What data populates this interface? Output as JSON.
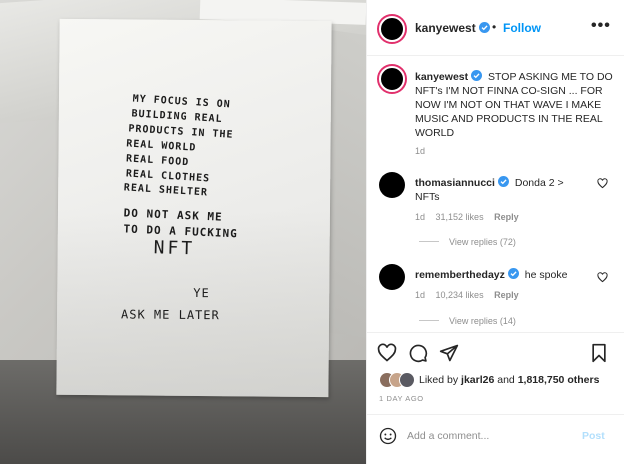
{
  "post": {
    "author": "kanyewest",
    "follow_label": "Follow",
    "separator": "•",
    "more_label": "•••"
  },
  "photo": {
    "note_lines_top": [
      "MY FOCUS IS ON",
      "BUILDING REAL",
      "PRODUCTS IN THE",
      "REAL WORLD",
      "REAL FOOD",
      "REAL CLOTHES",
      "REAL SHELTER"
    ],
    "note_lines_mid": [
      "DO NOT ASK ME",
      "TO DO A FUCKING"
    ],
    "note_big": "NFT",
    "note_ye": "YE",
    "note_later": "ASK ME LATER"
  },
  "caption": {
    "username": "kanyewest",
    "text": "STOP ASKING ME TO DO NFT's I'M NOT FINNA CO-SIGN ... FOR NOW I'M NOT ON THAT WAVE I MAKE MUSIC AND PRODUCTS IN THE REAL WORLD",
    "time": "1d"
  },
  "comments": [
    {
      "username": "thomasiannucci",
      "text": "Donda 2 > NFTs",
      "time": "1d",
      "likes": "31,152 likes",
      "reply_label": "Reply",
      "view_replies": "View replies (72)"
    },
    {
      "username": "rememberthedayz",
      "text": "he spoke",
      "time": "1d",
      "likes": "10,234 likes",
      "reply_label": "Reply",
      "view_replies": "View replies (14)"
    }
  ],
  "likes": {
    "prefix": "Liked by",
    "user": "jkarl26",
    "middle": "and",
    "count": "1,818,750 others"
  },
  "posted_ago": "1 DAY AGO",
  "add_comment": {
    "placeholder": "Add a comment...",
    "post_label": "Post"
  },
  "colors": {
    "link_blue": "#0095f6",
    "verified_blue": "#3897f0",
    "muted": "#8e8e8e",
    "post_disabled": "#b2dffc"
  },
  "icons": [
    "heart-icon",
    "comment-icon",
    "share-icon",
    "bookmark-icon",
    "emoji-icon",
    "verified-icon",
    "more-icon"
  ]
}
